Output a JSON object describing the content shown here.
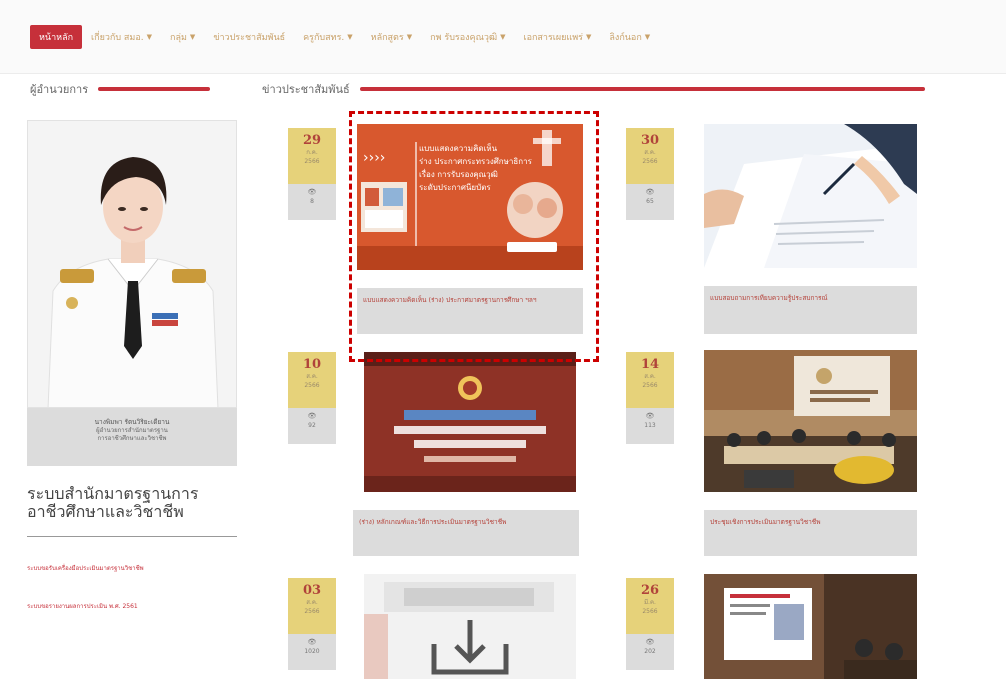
{
  "nav": {
    "items": [
      {
        "label": "หน้าหลัก",
        "dropdown": false,
        "active": true
      },
      {
        "label": "เกี่ยวกับ สมอ.",
        "dropdown": true,
        "active": false
      },
      {
        "label": "กลุ่ม",
        "dropdown": true,
        "active": false
      },
      {
        "label": "ข่าวประชาสัมพันธ์",
        "dropdown": false,
        "active": false
      },
      {
        "label": "ครูกับสทร.",
        "dropdown": true,
        "active": false
      },
      {
        "label": "หลักสูตร",
        "dropdown": true,
        "active": false
      },
      {
        "label": "กพ รับรองคุณวุฒิ",
        "dropdown": true,
        "active": false
      },
      {
        "label": "เอกสารเผยแพร่",
        "dropdown": true,
        "active": false
      },
      {
        "label": "ลิงก์นอก",
        "dropdown": true,
        "active": false
      }
    ]
  },
  "sections": {
    "executive_title": "ผู้อำนวยการ",
    "news_title": "ข่าวประชาสัมพันธ์"
  },
  "executive": {
    "name": "นางพิมพา รัตนวิริยะเดียาน",
    "position_1": "ผู้อำนวยการสำนักมาตรฐาน",
    "position_2": "การอาชีวศึกษาและวิชาชีพ"
  },
  "office": {
    "title": "ระบบสำนักมาตรฐานการอาชีวศึกษาและวิชาชีพ",
    "links": [
      "ระบบขอรับเครื่องมือประเมินมาตรฐานวิชาชีพ",
      "ระบบขอรายงานผลการประเมิน พ.ศ. 2561"
    ]
  },
  "news": [
    {
      "day": "29",
      "month": "ก.ค.",
      "year": "2566",
      "eye": "👁",
      "views": "8",
      "caption": "แบบแสดงความคิดเห็น (ร่าง) ประกาศมาตรฐานการศึกษา ฯลฯ",
      "image": "orange-poster"
    },
    {
      "day": "30",
      "month": "ส.ค.",
      "year": "2566",
      "eye": "👁",
      "views": "65",
      "caption": "แบบสอบถามการเทียบความรู้ประสบการณ์",
      "image": "signing-document"
    },
    {
      "day": "10",
      "month": "ส.ค.",
      "year": "2566",
      "eye": "👁",
      "views": "92",
      "caption": "(ร่าง) หลักเกณฑ์และวิธีการประเมินมาตรฐานวิชาชีพ",
      "image": "meeting-screen"
    },
    {
      "day": "14",
      "month": "ส.ค.",
      "year": "2566",
      "eye": "👁",
      "views": "113",
      "caption": "ประชุมเชิงการประเมินมาตรฐานวิชาชีพ",
      "image": "meeting-room"
    },
    {
      "day": "03",
      "month": "ส.ค.",
      "year": "2566",
      "eye": "👁",
      "views": "1020",
      "caption": "",
      "image": "download-icon"
    },
    {
      "day": "26",
      "month": "มี.ค.",
      "year": "2566",
      "eye": "👁",
      "views": "202",
      "caption": "",
      "image": "presentation-room"
    }
  ],
  "poster": {
    "line1": "แบบแสดงความคิดเห็น",
    "line2": "ร่าง ประกาศกระทรวงศึกษาธิการ",
    "line3": "เรื่อง การรับรองคุณวุฒิ",
    "line4": "ระดับประกาศนียบัตร"
  },
  "colors": {
    "brand_red": "#c6303a",
    "date_gold": "#e6d27a",
    "caption_gray": "#dcdcdc",
    "poster_orange": "#d8582e"
  }
}
